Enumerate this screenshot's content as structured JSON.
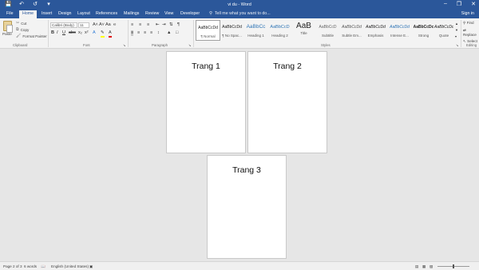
{
  "titlebar": {
    "title": "vi du - Word",
    "qat_icons": [
      "save-icon",
      "undo-icon",
      "redo-icon",
      "customize-icon"
    ],
    "window_buttons": [
      "minimize-icon",
      "restore-icon",
      "close-icon"
    ]
  },
  "tabs": [
    {
      "label": "File"
    },
    {
      "label": "Home",
      "active": true
    },
    {
      "label": "Insert"
    },
    {
      "label": "Design"
    },
    {
      "label": "Layout"
    },
    {
      "label": "References"
    },
    {
      "label": "Mailings"
    },
    {
      "label": "Review"
    },
    {
      "label": "View"
    },
    {
      "label": "Developer"
    }
  ],
  "tell_me": "Tell me what you want to do...",
  "sign_in": "Sign in",
  "clipboard": {
    "paste": "Paste",
    "cut": "Cut",
    "copy": "Copy",
    "format_painter": "Format Painter",
    "group_label": "Clipboard"
  },
  "font": {
    "name": "Calibri (Body)",
    "size": "11",
    "group_label": "Font"
  },
  "paragraph": {
    "group_label": "Paragraph"
  },
  "styles": {
    "group_label": "Styles",
    "items": [
      {
        "preview": "AaBbCcDd",
        "name": "¶ Normal"
      },
      {
        "preview": "AaBbCcDd",
        "name": "¶ No Spac..."
      },
      {
        "preview": "AaBbCc",
        "name": "Heading 1"
      },
      {
        "preview": "AaBbCcD",
        "name": "Heading 2"
      },
      {
        "preview": "AaB",
        "name": "Title"
      },
      {
        "preview": "AaBbCcD",
        "name": "Subtitle"
      },
      {
        "preview": "AaBbCcDd",
        "name": "Subtle Em..."
      },
      {
        "preview": "AaBbCcDd",
        "name": "Emphasis"
      },
      {
        "preview": "AaBbCcDd",
        "name": "Intense E..."
      },
      {
        "preview": "AaBbCcDc",
        "name": "Strong"
      },
      {
        "preview": "AaBbCcDd",
        "name": "Quote"
      }
    ]
  },
  "editing": {
    "find": "Find",
    "replace": "Replace",
    "select": "Select",
    "group_label": "Editing"
  },
  "pages": [
    {
      "heading": "Trang 1"
    },
    {
      "heading": "Trang 2"
    },
    {
      "heading": "Trang 3"
    }
  ],
  "statusbar": {
    "page_info": "Page 2 of 3",
    "word_count": "6 words",
    "language": "English (United States)",
    "zoom_percent": 50
  },
  "colors": {
    "accent": "#2b579a",
    "ribbon_bg": "#f3f3f3",
    "canvas_bg": "#e6e6e6"
  }
}
